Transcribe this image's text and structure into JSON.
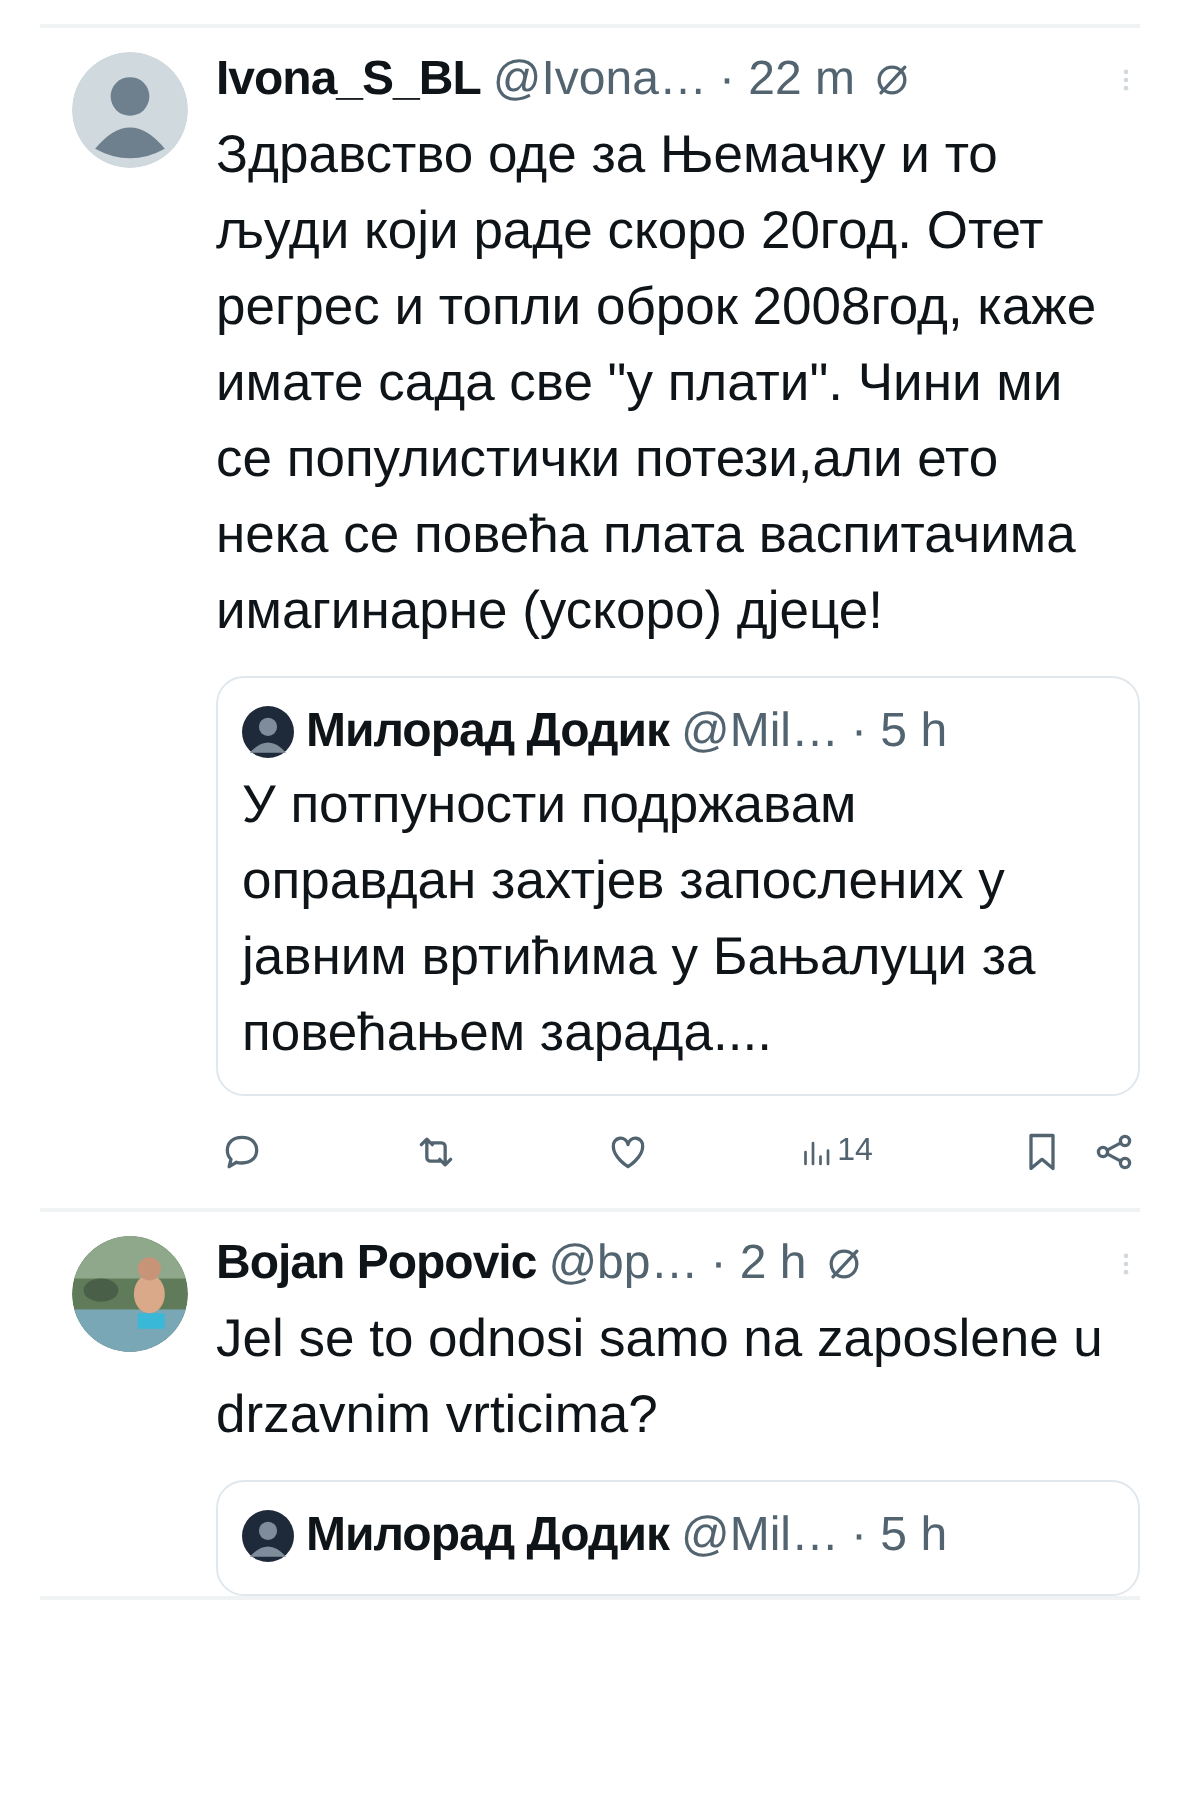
{
  "posts": [
    {
      "name": "Ivona_S_BL",
      "handle": "@Ivona…",
      "time": "· 22 m",
      "kind": "default",
      "text": "Здравство оде за Њемачку и то људи који раде скоро 20год. Отет регрес и топли оброк 2008год, каже имате сада све \"у плати\". Чини ми се популистички потези,али ето нека се повећа плата васпитачима имагинарне (ускоро) дјеце!",
      "quote": {
        "name": "Милорад Додик",
        "handle": "@Mil…",
        "time": "· 5 h",
        "text": "У потпуности подржавам оправдан захтјев запослених у јавним вртићима у Бањалуци за повећањем зарада...."
      },
      "views": "14"
    },
    {
      "name": "Bojan Popovic",
      "handle": "@bp…",
      "time": "· 2 h",
      "kind": "picture",
      "text": "Jel se to odnosi samo na zaposlene u drzavnim vrticima?",
      "quote": {
        "name": "Милорад Додик",
        "handle": "@Mil…",
        "time": "· 5 h"
      }
    }
  ]
}
